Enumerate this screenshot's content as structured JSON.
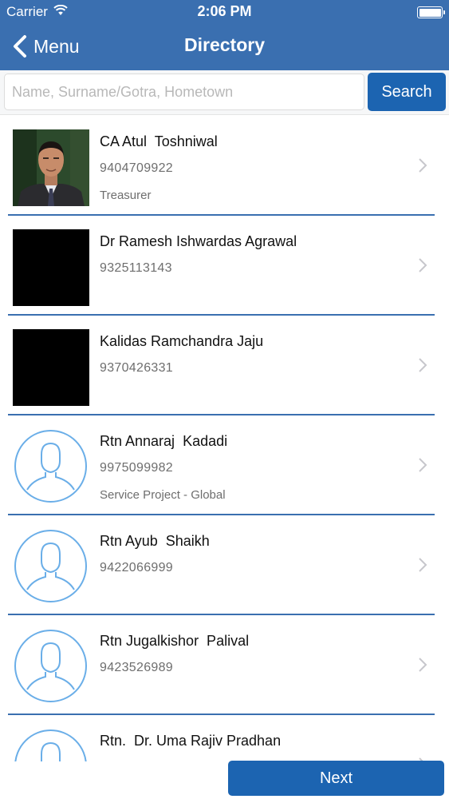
{
  "status_bar": {
    "carrier": "Carrier",
    "time": "2:06 PM"
  },
  "nav": {
    "back_label": "Menu",
    "title": "Directory"
  },
  "search": {
    "placeholder": "Name, Surname/Gotra, Hometown",
    "value": "",
    "button_label": "Search"
  },
  "members": [
    {
      "name": "CA Atul  Toshniwal",
      "phone": "9404709922",
      "role": "Treasurer",
      "photo": "person-photo"
    },
    {
      "name": "Dr Ramesh Ishwardas Agrawal",
      "phone": "9325113143",
      "role": "",
      "photo": "black-photo"
    },
    {
      "name": "Kalidas Ramchandra Jaju",
      "phone": "9370426331",
      "role": "",
      "photo": "black-photo"
    },
    {
      "name": "Rtn Annaraj  Kadadi",
      "phone": "9975099982",
      "role": "Service Project - Global",
      "photo": "avatar-placeholder"
    },
    {
      "name": "Rtn Ayub  Shaikh",
      "phone": "9422066999",
      "role": "",
      "photo": "avatar-placeholder"
    },
    {
      "name": "Rtn Jugalkishor  Palival",
      "phone": "9423526989",
      "role": "",
      "photo": "avatar-placeholder"
    },
    {
      "name": "Rtn.  Dr. Uma Rajiv Pradhan",
      "phone": "",
      "role": "",
      "photo": "avatar-placeholder"
    }
  ],
  "footer": {
    "next_label": "Next"
  },
  "colors": {
    "header": "#3a6fb0",
    "button": "#1c64b1",
    "avatar_stroke": "#6aaee8",
    "divider": "#3a6fb0"
  }
}
